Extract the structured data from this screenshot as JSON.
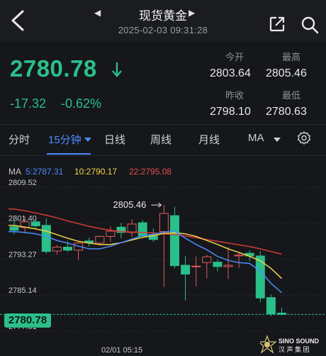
{
  "header": {
    "title": "现货黄金",
    "timestamp": "2025-02-03 09:31:28",
    "prev_arrow": "◀",
    "next_arrow": "▶"
  },
  "quote": {
    "price": "2780.78",
    "change": "-17.32",
    "change_pct": "-0.62%",
    "open_label": "今开",
    "open": "2803.64",
    "high_label": "最高",
    "high": "2805.46",
    "prev_close_label": "昨收",
    "prev_close": "2798.10",
    "low_label": "最低",
    "low": "2780.63"
  },
  "tabs": [
    {
      "label": "分时"
    },
    {
      "label": "15分钟"
    },
    {
      "label": "日线"
    },
    {
      "label": "周线"
    },
    {
      "label": "月线"
    },
    {
      "label": "MA"
    }
  ],
  "ma_legend": {
    "prefix": "MA",
    "ma5": "5:2787.31",
    "ma10": "10:2790.17",
    "ma22": "22:2795.08"
  },
  "colors": {
    "up": "#e35a5a",
    "down": "#2bbf8a",
    "ma5": "#4a8cff",
    "ma10": "#f2d34a",
    "ma22": "#d63a3a",
    "accent": "#4a8cff"
  },
  "icons": {
    "back": "chevron-left-icon",
    "share": "share-icon",
    "search": "search-icon",
    "settings": "gear-icon",
    "down": "down-arrow-icon"
  },
  "chart_data": {
    "type": "candlestick",
    "ylim": [
      2777.01,
      2809.52
    ],
    "y_ticks": [
      "2809.52",
      "2801.40",
      "2793.27",
      "2785.14",
      "2777.01"
    ],
    "x_label": "02/01 05:15",
    "high_annotation": "2805.46",
    "current_price_label": "2780.78",
    "candles": [
      {
        "o": 2800.6,
        "h": 2802.2,
        "l": 2798.9,
        "c": 2799.8
      },
      {
        "o": 2800.4,
        "h": 2802.9,
        "l": 2799.1,
        "c": 2801.7
      },
      {
        "o": 2801.7,
        "h": 2802.2,
        "l": 2800.3,
        "c": 2800.8
      },
      {
        "o": 2800.9,
        "h": 2802.5,
        "l": 2794.5,
        "c": 2795.0
      },
      {
        "o": 2795.1,
        "h": 2796.5,
        "l": 2794.3,
        "c": 2796.0
      },
      {
        "o": 2796.0,
        "h": 2797.3,
        "l": 2794.9,
        "c": 2795.3
      },
      {
        "o": 2795.3,
        "h": 2797.4,
        "l": 2793.1,
        "c": 2796.9
      },
      {
        "o": 2797.4,
        "h": 2798.1,
        "l": 2796.1,
        "c": 2797.0
      },
      {
        "o": 2796.9,
        "h": 2798.6,
        "l": 2796.3,
        "c": 2798.4
      },
      {
        "o": 2798.4,
        "h": 2800.7,
        "l": 2797.2,
        "c": 2799.6
      },
      {
        "o": 2800.5,
        "h": 2801.5,
        "l": 2798.0,
        "c": 2799.3
      },
      {
        "o": 2799.3,
        "h": 2802.3,
        "l": 2798.3,
        "c": 2801.2
      },
      {
        "o": 2801.5,
        "h": 2802.1,
        "l": 2798.1,
        "c": 2798.5
      },
      {
        "o": 2798.7,
        "h": 2800.2,
        "l": 2797.2,
        "c": 2797.7
      },
      {
        "o": 2799.5,
        "h": 2805.5,
        "l": 2787.0,
        "c": 2803.6
      },
      {
        "o": 2803.1,
        "h": 2805.1,
        "l": 2791.2,
        "c": 2791.8
      },
      {
        "o": 2791.9,
        "h": 2794.0,
        "l": 2783.9,
        "c": 2789.9
      },
      {
        "o": 2791.6,
        "h": 2793.9,
        "l": 2787.2,
        "c": 2791.7
      },
      {
        "o": 2792.5,
        "h": 2794.3,
        "l": 2788.9,
        "c": 2793.8
      },
      {
        "o": 2792.6,
        "h": 2793.2,
        "l": 2790.5,
        "c": 2791.6
      },
      {
        "o": 2791.6,
        "h": 2796.0,
        "l": 2788.8,
        "c": 2791.9
      },
      {
        "o": 2794.0,
        "h": 2794.8,
        "l": 2791.3,
        "c": 2794.2
      },
      {
        "o": 2794.6,
        "h": 2795.3,
        "l": 2792.8,
        "c": 2794.0
      },
      {
        "o": 2794.0,
        "h": 2795.1,
        "l": 2783.5,
        "c": 2784.5
      },
      {
        "o": 2784.6,
        "h": 2785.3,
        "l": 2780.4,
        "c": 2780.9
      },
      {
        "o": 2781.1,
        "h": 2782.3,
        "l": 2780.6,
        "c": 2780.8
      }
    ],
    "ma5": [
      2799.5,
      2799.3,
      2799.0,
      2798.4,
      2797.5,
      2796.9,
      2796.2,
      2795.6,
      2795.6,
      2796.2,
      2797.0,
      2797.8,
      2798.6,
      2798.9,
      2799.4,
      2799.6,
      2798.0,
      2796.6,
      2795.4,
      2793.9,
      2793.0,
      2792.5,
      2792.3,
      2790.6,
      2787.8,
      2785.7
    ],
    "ma10": [
      2800.9,
      2800.5,
      2800.1,
      2799.6,
      2798.8,
      2798.0,
      2797.3,
      2796.9,
      2796.6,
      2796.6,
      2797.0,
      2797.6,
      2798.2,
      2798.6,
      2799.1,
      2799.2,
      2799.0,
      2798.4,
      2797.5,
      2796.6,
      2795.6,
      2794.8,
      2793.9,
      2792.9,
      2791.2,
      2788.9
    ],
    "ma22": [
      2804.6,
      2804.2,
      2803.7,
      2803.2,
      2802.6,
      2801.9,
      2801.3,
      2800.7,
      2800.2,
      2799.8,
      2799.5,
      2799.4,
      2799.3,
      2799.2,
      2799.0,
      2798.8,
      2798.5,
      2798.1,
      2797.7,
      2797.3,
      2796.9,
      2796.5,
      2796.1,
      2795.6,
      2795.0,
      2794.4
    ]
  },
  "brand": {
    "line1": "SINO SOUND",
    "line2": "汉声集团"
  }
}
